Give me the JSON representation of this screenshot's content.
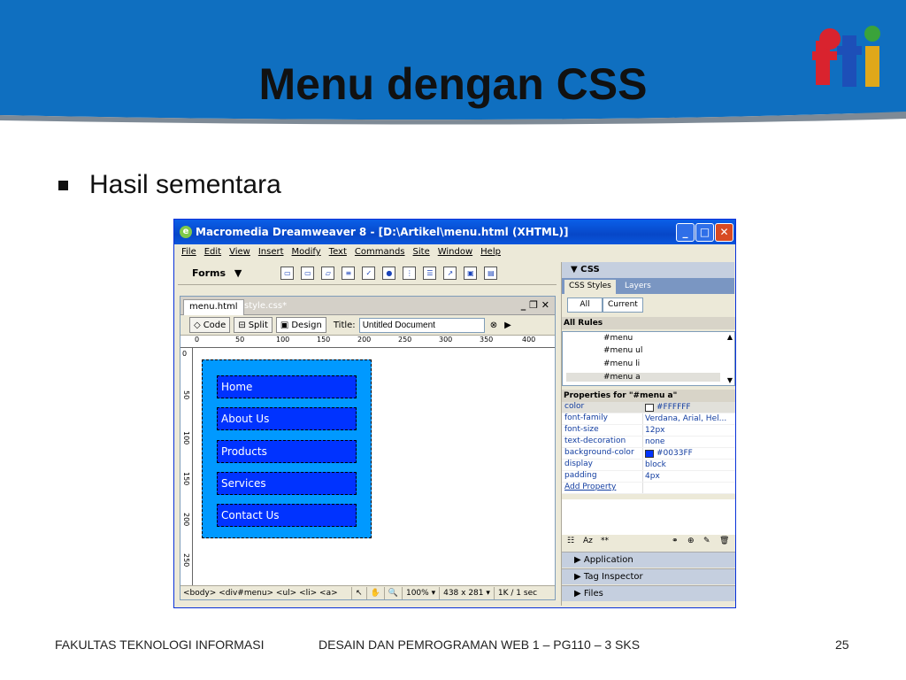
{
  "slide": {
    "title": "Menu dengan CSS",
    "bullet": "Hasil sementara",
    "footer_left": "FAKULTAS TEKNOLOGI INFORMASI",
    "footer_center": "DESAIN DAN PEMROGRAMAN WEB 1 – PG110 – 3 SKS",
    "page_number": "25",
    "colors": {
      "band": "#0f6fc0",
      "title": "#111111"
    }
  },
  "window": {
    "title": "Macromedia Dreamweaver 8 - [D:\\Artikel\\menu.html (XHTML)]",
    "menus": [
      "File",
      "Edit",
      "View",
      "Insert",
      "Modify",
      "Text",
      "Commands",
      "Site",
      "Window",
      "Help"
    ],
    "insert_bar_label": "Forms",
    "insert_bar_dropdown": "▼"
  },
  "document": {
    "tabs": [
      "menu.html",
      "style.css*"
    ],
    "controls": "_ ❐ ✕",
    "view_buttons": [
      "Code",
      "Split",
      "Design"
    ],
    "title_label": "Title:",
    "title_value": "Untitled Document",
    "ruler_marks": [
      "0",
      "50",
      "100",
      "150",
      "200",
      "250",
      "300",
      "350",
      "400"
    ],
    "vruler_marks": [
      "0",
      "50",
      "100",
      "150",
      "200",
      "250"
    ],
    "menu_items": [
      "Home",
      "About Us",
      "Products",
      "Services",
      "Contact Us"
    ],
    "menu_colors": {
      "container": "#0099ff",
      "item": "#0033ff",
      "text": "#ffffff"
    },
    "status": {
      "tag_path": "<body> <div#menu> <ul> <li> <a>",
      "zoom": "100%",
      "dimensions": "438 x 281",
      "size": "1K / 1 sec"
    }
  },
  "panel": {
    "title": "▼ CSS",
    "tabs": [
      "CSS Styles",
      "Layers"
    ],
    "modes": [
      "All",
      "Current"
    ],
    "rules_header": "All Rules",
    "rules": [
      "#menu",
      "#menu ul",
      "#menu li",
      "#menu a"
    ],
    "properties_header": "Properties for \"#menu a\"",
    "properties": [
      {
        "key": "color",
        "value": "#FFFFFF",
        "swatch": "#ffffff"
      },
      {
        "key": "font-family",
        "value": "Verdana, Arial, Hel..."
      },
      {
        "key": "font-size",
        "value": "12px"
      },
      {
        "key": "text-decoration",
        "value": "none"
      },
      {
        "key": "background-color",
        "value": "#0033FF",
        "swatch": "#0033ff"
      },
      {
        "key": "display",
        "value": "block"
      },
      {
        "key": "padding",
        "value": "4px"
      },
      {
        "key": "Add Property",
        "value": ""
      }
    ],
    "groups": [
      "▶ Application",
      "▶ Tag Inspector",
      "▶ Files"
    ]
  }
}
